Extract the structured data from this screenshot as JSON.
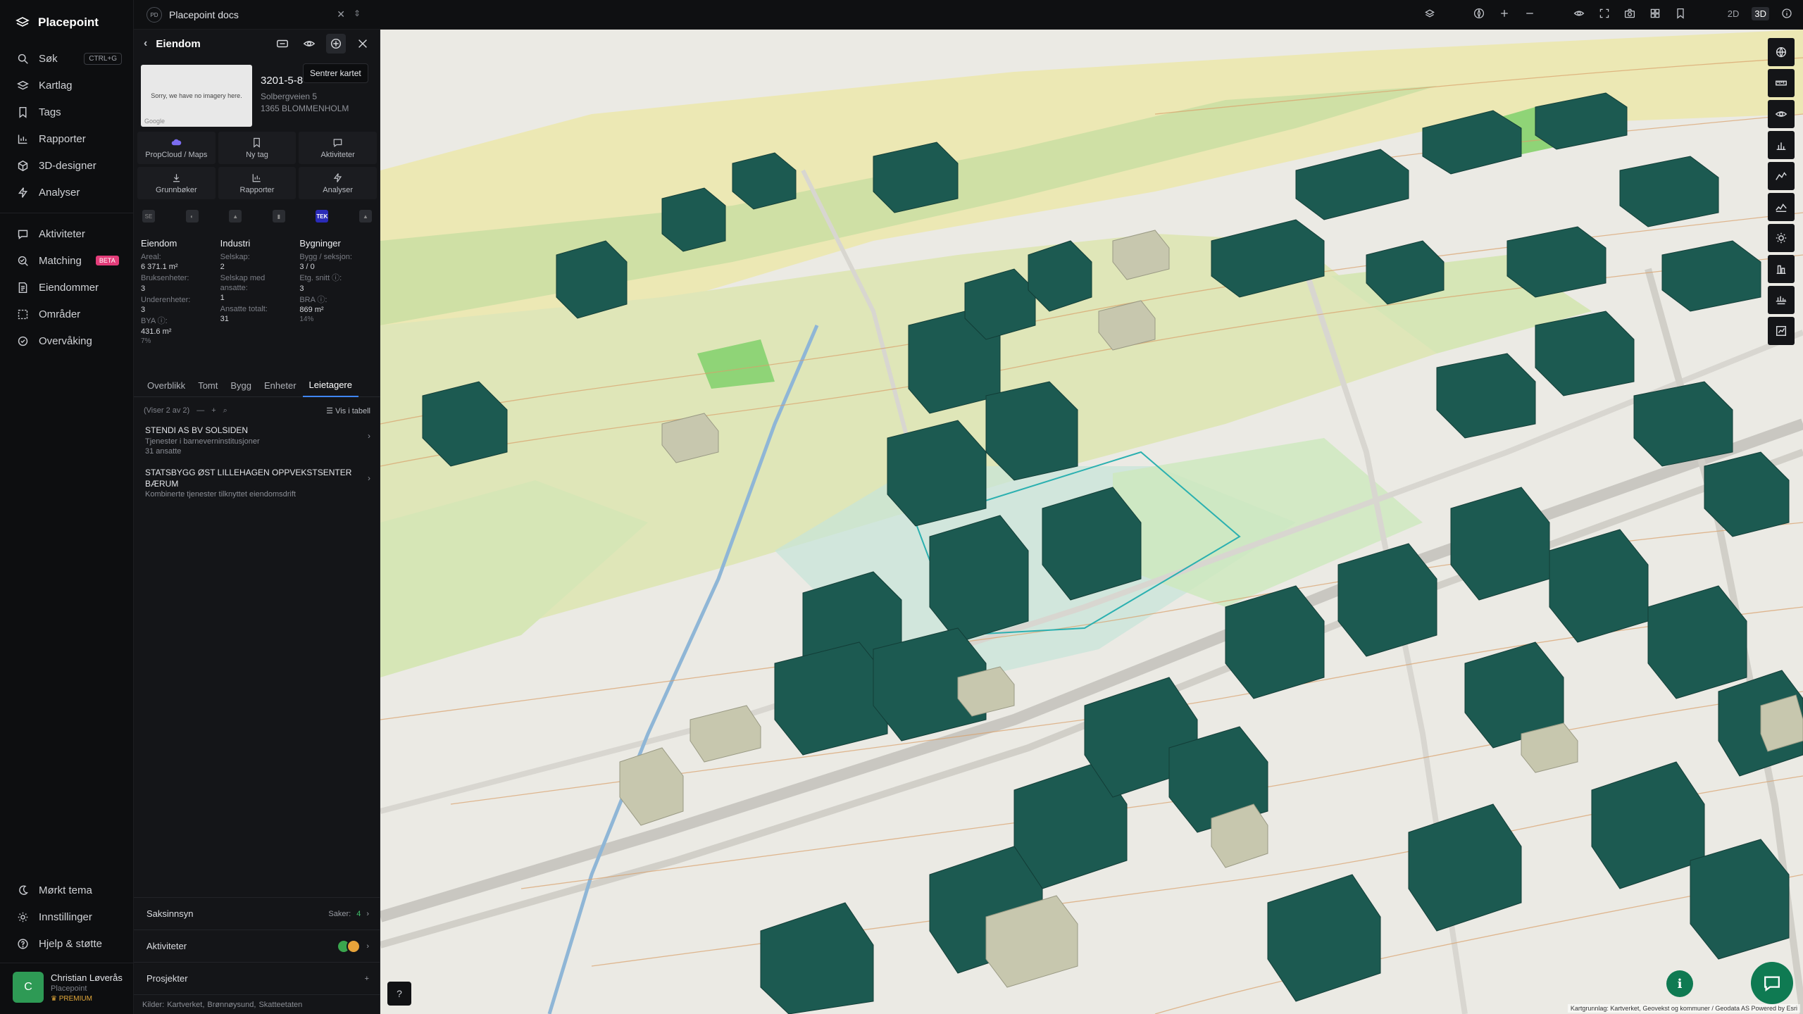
{
  "app": {
    "name": "Placepoint"
  },
  "nav": {
    "items": [
      {
        "label": "Søk",
        "kbd": "CTRL+G"
      },
      {
        "label": "Kartlag"
      },
      {
        "label": "Tags"
      },
      {
        "label": "Rapporter"
      },
      {
        "label": "3D-designer"
      },
      {
        "label": "Analyser"
      }
    ],
    "items2": [
      {
        "label": "Aktiviteter"
      },
      {
        "label": "Matching",
        "badge": "BETA"
      },
      {
        "label": "Eiendommer"
      },
      {
        "label": "Områder"
      },
      {
        "label": "Overvåking"
      }
    ],
    "bottom": [
      {
        "label": "Mørkt tema"
      },
      {
        "label": "Innstillinger"
      },
      {
        "label": "Hjelp & støtte"
      }
    ],
    "user": {
      "initial": "C",
      "name": "Christian Løverås",
      "org": "Placepoint",
      "plan": "PREMIUM"
    }
  },
  "topbar": {
    "doc_badge": "PD",
    "doc_title": "Placepoint docs",
    "mode_2d": "2D",
    "mode_3d": "3D",
    "active_mode": "3D"
  },
  "panel": {
    "title": "Eiendom",
    "tooltip": "Sentrer kartet",
    "property": {
      "id": "3201-5-8",
      "address_line1": "Solbergveien 5",
      "address_line2": "1365 BLOMMENHOLM",
      "image_text": "Sorry, we have no imagery here.",
      "image_credit": "Google"
    },
    "actions": [
      {
        "label": "PropCloud / Maps",
        "icon": "cloud-icon"
      },
      {
        "label": "Ny tag",
        "icon": "bookmark-icon"
      },
      {
        "label": "Aktiviteter",
        "icon": "message-icon"
      },
      {
        "label": "Grunnbøker",
        "icon": "download-icon"
      },
      {
        "label": "Rapporter",
        "icon": "chart-icon"
      },
      {
        "label": "Analyser",
        "icon": "bolt-icon"
      }
    ],
    "sources_row": {
      "tek_label": "TEK"
    },
    "stats": {
      "eiendom": {
        "head": "Eiendom",
        "rows": [
          {
            "label": "Areal:",
            "value": "6 371.1 m²"
          },
          {
            "label": "Bruksenheter:",
            "value": "3"
          },
          {
            "label": "Underenheter:",
            "value": "3"
          },
          {
            "label": "BYA ⓘ:",
            "value": "431.6 m²",
            "sub": "7%"
          }
        ]
      },
      "industri": {
        "head": "Industri",
        "rows": [
          {
            "label": "Selskap:",
            "value": "2"
          },
          {
            "label": "Selskap med ansatte:",
            "value": "1"
          },
          {
            "label": "Ansatte totalt:",
            "value": "31"
          }
        ]
      },
      "bygninger": {
        "head": "Bygninger",
        "rows": [
          {
            "label": "Bygg / seksjon:",
            "value": "3 / 0"
          },
          {
            "label": "Etg. snitt ⓘ:",
            "value": "3"
          },
          {
            "label": "BRA ⓘ:",
            "value": "869 m²",
            "sub": "14%"
          }
        ]
      }
    },
    "tabs": [
      "Overblikk",
      "Tomt",
      "Bygg",
      "Enheter",
      "Leietagere"
    ],
    "active_tab": "Leietagere",
    "list": {
      "count_text": "(Viser 2 av 2)",
      "table_link": "Vis i tabell"
    },
    "tenants": [
      {
        "name": "STENDI AS BV SOLSIDEN",
        "desc": "Tjenester i barneverninstitusjoner",
        "extra": "31 ansatte"
      },
      {
        "name": "STATSBYGG ØST LILLEHAGEN OPPVEKSTSENTER BÆRUM",
        "desc": "Kombinerte tjenester tilknyttet eiendomsdrift",
        "extra": ""
      }
    ],
    "bottom": {
      "saksinnsyn": "Saksinnsyn",
      "saker_label": "Saker:",
      "saker_value": "4",
      "aktiviteter": "Aktiviteter",
      "prosjekter": "Prosjekter",
      "sources_label": "Kilder:",
      "sources": [
        "Kartverket,",
        "Brønnøysund,",
        "Skatteetaten"
      ]
    }
  },
  "map": {
    "attribution": "Kartgrunnlag: Kartverket, Geovekst og kommuner / Geodata AS Powered by Esri",
    "help_label": "?",
    "info_label": "i",
    "accent": "#0f7a52",
    "building_color": "#1c5a51"
  }
}
